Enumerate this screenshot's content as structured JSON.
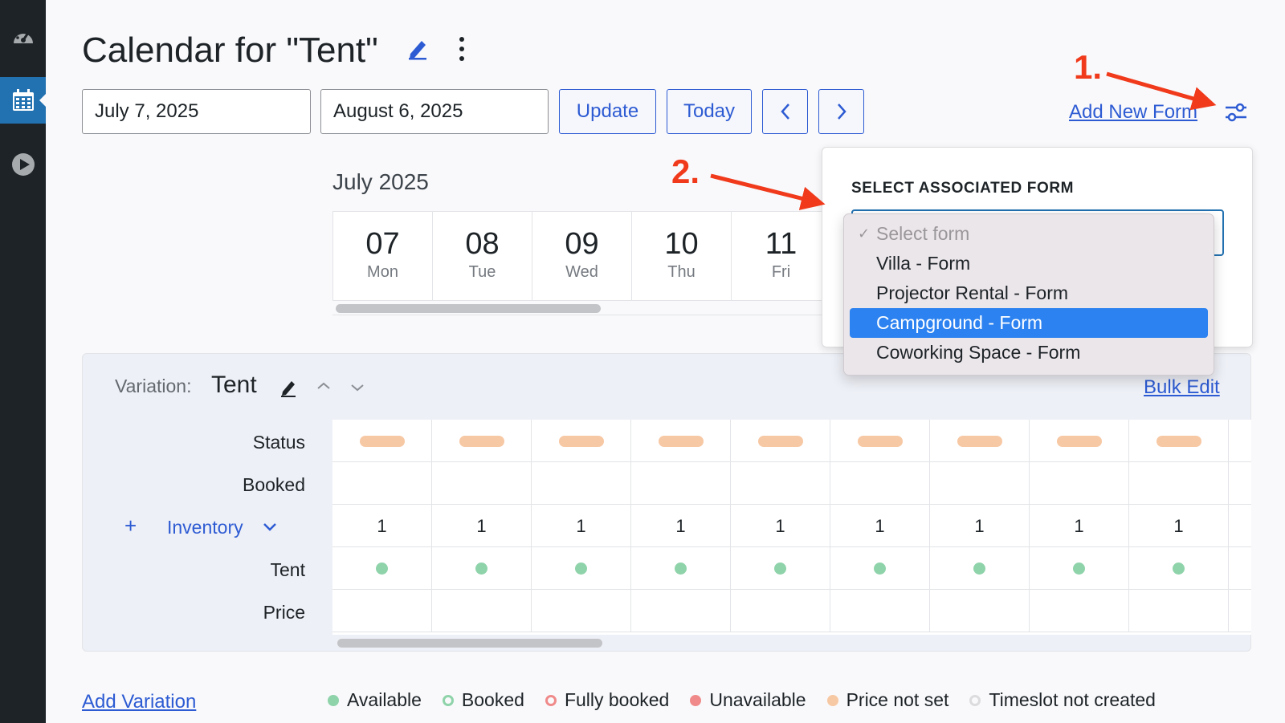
{
  "sidebar": {
    "items": [
      {
        "icon": "dashboard-gauge-icon"
      },
      {
        "icon": "calendar-icon",
        "active": true
      },
      {
        "icon": "play-circle-icon"
      }
    ]
  },
  "header": {
    "title": "Calendar for \"Tent\"",
    "start_date": "July 7, 2025",
    "end_date": "August 6, 2025",
    "update_label": "Update",
    "today_label": "Today",
    "add_new_form_label": "Add New Form"
  },
  "calendar": {
    "month_label": "July 2025",
    "days": [
      {
        "num": "07",
        "name": "Mon"
      },
      {
        "num": "08",
        "name": "Tue"
      },
      {
        "num": "09",
        "name": "Wed"
      },
      {
        "num": "10",
        "name": "Thu"
      },
      {
        "num": "11",
        "name": "Fri"
      }
    ]
  },
  "variation": {
    "label": "Variation:",
    "name": "Tent",
    "bulk_edit_label": "Bulk Edit",
    "rows": {
      "status": "Status",
      "booked": "Booked",
      "inventory": "Inventory",
      "tent": "Tent",
      "price": "Price"
    },
    "inventory_values": [
      "1",
      "1",
      "1",
      "1",
      "1",
      "1",
      "1",
      "1",
      "1"
    ]
  },
  "footer": {
    "add_variation_label": "Add Variation",
    "legend": [
      {
        "label": "Available",
        "color": "#8fd3aa",
        "style": "filled"
      },
      {
        "label": "Booked",
        "color": "#8fd3aa",
        "style": "ring"
      },
      {
        "label": "Fully booked",
        "color": "#f08a8a",
        "style": "ring"
      },
      {
        "label": "Unavailable",
        "color": "#f08a8a",
        "style": "filled"
      },
      {
        "label": "Price not set",
        "color": "#f7c8a4",
        "style": "filled"
      },
      {
        "label": "Timeslot not created",
        "color": "#dcdcde",
        "style": "ring"
      }
    ]
  },
  "form_popover": {
    "title": "SELECT ASSOCIATED FORM",
    "options": [
      {
        "label": "Select form",
        "checked": true,
        "muted": true
      },
      {
        "label": "Villa - Form"
      },
      {
        "label": "Projector Rental - Form"
      },
      {
        "label": "Campground - Form",
        "highlighted": true
      },
      {
        "label": "Coworking Space - Form"
      }
    ]
  },
  "annotations": {
    "step1": "1.",
    "step2": "2."
  },
  "colors": {
    "accent": "#2d5bd3",
    "highlight": "#2c82f0",
    "annotation": "#f03a1b",
    "status_pill": "#f7c8a4",
    "available_dot": "#8fd3aa"
  }
}
